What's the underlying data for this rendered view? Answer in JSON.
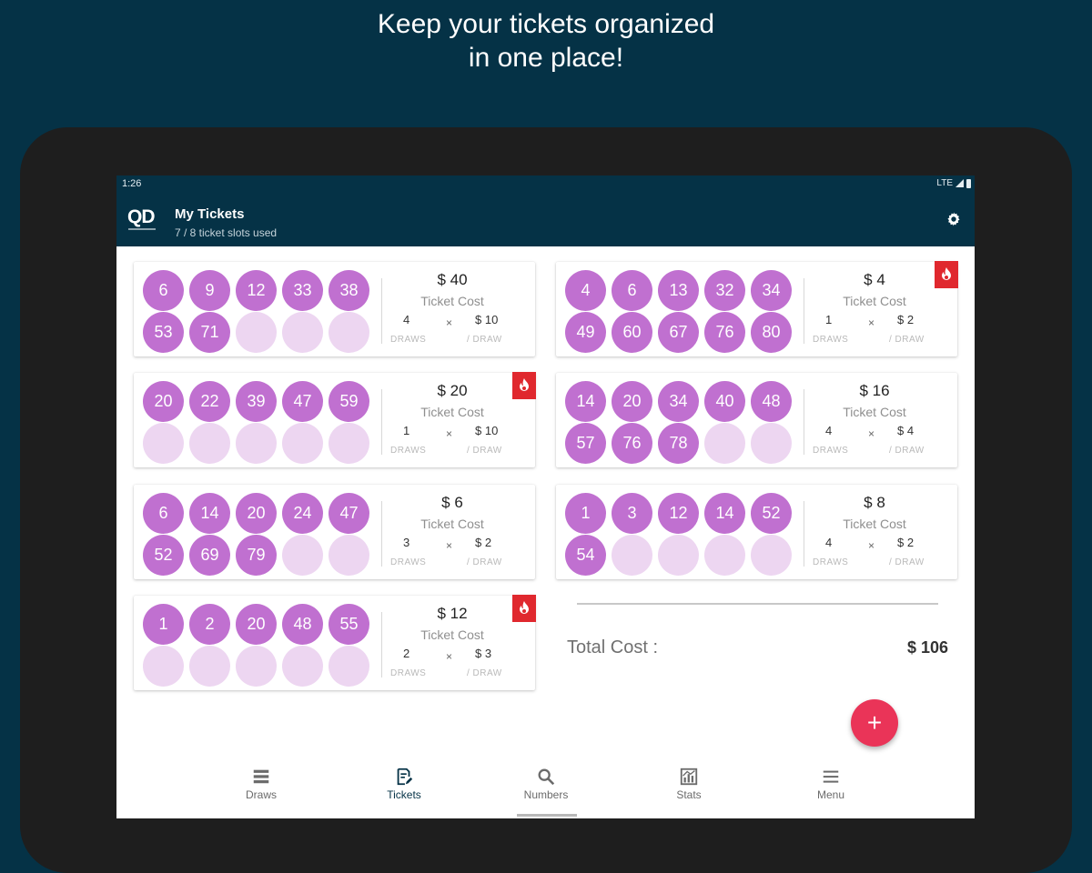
{
  "headline": {
    "line1": "Keep your tickets organized",
    "line2": "in one place!"
  },
  "statusbar": {
    "time": "1:26",
    "network": "LTE"
  },
  "appbar": {
    "logo": "QD",
    "title": "My Tickets",
    "subtitle": "7 / 8 ticket slots used"
  },
  "ticket_labels": {
    "cost": "Ticket Cost",
    "draws": "DRAWS",
    "per_draw": "/ DRAW",
    "times": "×"
  },
  "tickets": [
    {
      "numbers": [
        "6",
        "9",
        "12",
        "33",
        "38",
        "53",
        "71"
      ],
      "cost": "$ 40",
      "draws": "4",
      "per_draw": "$ 10",
      "hot": false
    },
    {
      "numbers": [
        "4",
        "6",
        "13",
        "32",
        "34",
        "49",
        "60",
        "67",
        "76",
        "80"
      ],
      "cost": "$ 4",
      "draws": "1",
      "per_draw": "$ 2",
      "hot": true
    },
    {
      "numbers": [
        "20",
        "22",
        "39",
        "47",
        "59"
      ],
      "cost": "$ 20",
      "draws": "1",
      "per_draw": "$ 10",
      "hot": true
    },
    {
      "numbers": [
        "14",
        "20",
        "34",
        "40",
        "48",
        "57",
        "76",
        "78"
      ],
      "cost": "$ 16",
      "draws": "4",
      "per_draw": "$ 4",
      "hot": false
    },
    {
      "numbers": [
        "6",
        "14",
        "20",
        "24",
        "47",
        "52",
        "69",
        "79"
      ],
      "cost": "$ 6",
      "draws": "3",
      "per_draw": "$ 2",
      "hot": false
    },
    {
      "numbers": [
        "1",
        "3",
        "12",
        "14",
        "52",
        "54"
      ],
      "cost": "$ 8",
      "draws": "4",
      "per_draw": "$ 2",
      "hot": false
    },
    {
      "numbers": [
        "1",
        "2",
        "20",
        "48",
        "55"
      ],
      "cost": "$ 12",
      "draws": "2",
      "per_draw": "$ 3",
      "hot": true
    }
  ],
  "total": {
    "label": "Total Cost :",
    "value": "$ 106"
  },
  "fab": {
    "label": "+"
  },
  "nav": [
    {
      "label": "Draws",
      "icon": "list-icon"
    },
    {
      "label": "Tickets",
      "icon": "ticket-edit-icon"
    },
    {
      "label": "Numbers",
      "icon": "search-icon"
    },
    {
      "label": "Stats",
      "icon": "stats-chart-icon"
    },
    {
      "label": "Menu",
      "icon": "menu-icon"
    }
  ],
  "colors": {
    "background": "#053246",
    "ball_filled": "#c070d0",
    "ball_empty": "#edd6f1",
    "hot_badge": "#e0282e",
    "fab": "#ea3458"
  }
}
